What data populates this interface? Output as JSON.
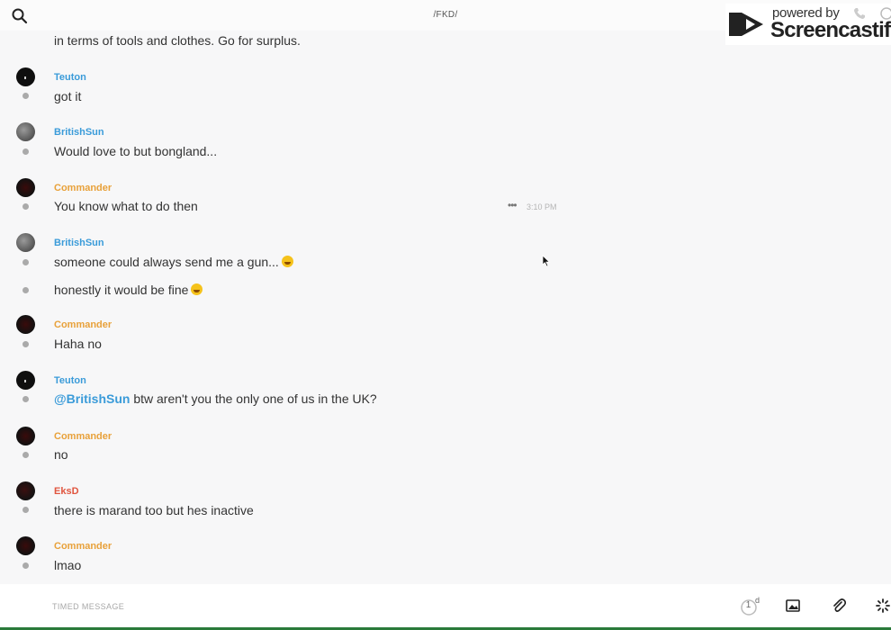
{
  "header": {
    "channel_title": "/FKD/",
    "search_icon": "search-icon"
  },
  "watermark": {
    "powered_by": "powered by",
    "brand": "Screencastify"
  },
  "messages": [
    {
      "type": "continuation",
      "text": "in terms of tools and clothes. Go for surplus."
    },
    {
      "author": "Teuton",
      "author_color": "#3a9bd9",
      "lines": [
        "got it"
      ]
    },
    {
      "author": "BritishSun",
      "author_color": "#3a9bd9",
      "lines": [
        "Would love to but bongland..."
      ]
    },
    {
      "author": "Commander",
      "author_color": "#e8a13a",
      "lines": [
        "You know what to do then"
      ],
      "time": "3:10 PM"
    },
    {
      "author": "BritishSun",
      "author_color": "#3a9bd9",
      "lines": [
        "someone could always send me a gun...",
        "honestly it would be fine"
      ]
    },
    {
      "author": "Commander",
      "author_color": "#e8a13a",
      "lines": [
        "Haha no"
      ]
    },
    {
      "author": "Teuton",
      "author_color": "#3a9bd9",
      "mention": "@BritishSun",
      "lines": [
        " btw aren't you the only one of us in the UK?"
      ]
    },
    {
      "author": "Commander",
      "author_color": "#e8a13a",
      "lines": [
        "no"
      ]
    },
    {
      "author": "EksD",
      "author_color": "#e0553f",
      "lines": [
        "there is marand too but hes inactive"
      ]
    },
    {
      "author": "Commander",
      "author_color": "#e8a13a",
      "lines": [
        "lmao"
      ]
    }
  ],
  "composer": {
    "placeholder": "TIMED MESSAGE",
    "timer_value": "1",
    "timer_unit": "d"
  },
  "colors": {
    "accent_blue": "#3a9bd9",
    "accent_orange": "#e8a13a",
    "accent_red": "#e0553f"
  }
}
